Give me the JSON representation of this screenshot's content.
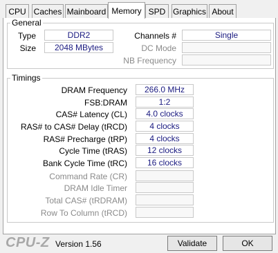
{
  "tabs": [
    {
      "label": "CPU"
    },
    {
      "label": "Caches"
    },
    {
      "label": "Mainboard"
    },
    {
      "label": "Memory"
    },
    {
      "label": "SPD"
    },
    {
      "label": "Graphics"
    },
    {
      "label": "About"
    }
  ],
  "active_tab": "Memory",
  "general": {
    "title": "General",
    "type_label": "Type",
    "type_value": "DDR2",
    "size_label": "Size",
    "size_value": "2048 MBytes",
    "channels_label": "Channels #",
    "channels_value": "Single",
    "dcmode_label": "DC Mode",
    "dcmode_value": "",
    "nbfreq_label": "NB Frequency",
    "nbfreq_value": ""
  },
  "timings": {
    "title": "Timings",
    "rows": [
      {
        "label": "DRAM Frequency",
        "value": "266.0 MHz"
      },
      {
        "label": "FSB:DRAM",
        "value": "1:2"
      },
      {
        "label": "CAS# Latency (CL)",
        "value": "4.0 clocks"
      },
      {
        "label": "RAS# to CAS# Delay (tRCD)",
        "value": "4 clocks"
      },
      {
        "label": "RAS# Precharge (tRP)",
        "value": "4 clocks"
      },
      {
        "label": "Cycle Time (tRAS)",
        "value": "12 clocks"
      },
      {
        "label": "Bank Cycle Time (tRC)",
        "value": "16 clocks"
      },
      {
        "label": "Command Rate (CR)",
        "value": ""
      },
      {
        "label": "DRAM Idle Timer",
        "value": ""
      },
      {
        "label": "Total CAS# (tRDRAM)",
        "value": ""
      },
      {
        "label": "Row To Column (tRCD)",
        "value": ""
      }
    ]
  },
  "footer": {
    "logo": "CPU-Z",
    "version": "Version 1.56",
    "validate_label": "Validate",
    "ok_label": "OK"
  },
  "colors": {
    "field_text": "#1a1a80",
    "dim_label": "#8a8a8a"
  }
}
